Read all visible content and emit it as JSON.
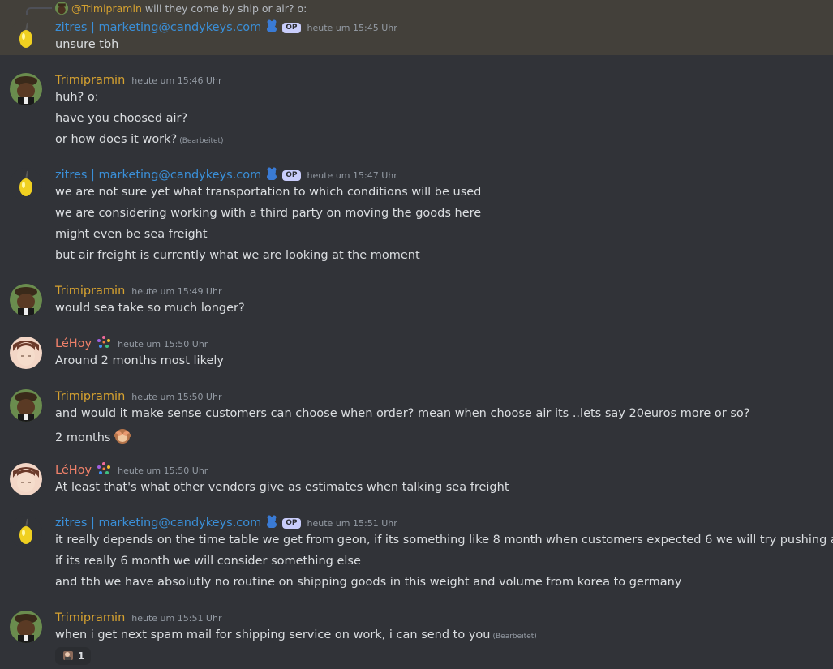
{
  "reply": {
    "mention": "@Trimipramin",
    "text": "will they come by ship or air? o:"
  },
  "badge_op": "OP",
  "messages": [
    {
      "author": "zitres | marketing@candykeys.com",
      "time": "heute um 15:45 Uhr",
      "lines": [
        "unsure tbh"
      ]
    },
    {
      "author": "Trimipramin",
      "time": "heute um 15:46 Uhr",
      "lines": [
        "huh? o:",
        "have you choosed air?",
        "or how does it work?"
      ],
      "edited": "(Bearbeitet)"
    },
    {
      "author": "zitres | marketing@candykeys.com",
      "time": "heute um 15:47 Uhr",
      "lines": [
        "we are not sure yet what transportation to which conditions will be used",
        "we are considering working with a third party on moving the goods here",
        "might even be sea freight",
        "but air freight is currently what we are looking at the moment"
      ]
    },
    {
      "author": "Trimipramin",
      "time": "heute um 15:49 Uhr",
      "lines": [
        "would sea take so much longer?"
      ]
    },
    {
      "author": "LéHoy",
      "time": "heute um 15:50 Uhr",
      "lines": [
        "Around 2 months most likely"
      ]
    },
    {
      "author": "Trimipramin",
      "time": "heute um 15:50 Uhr",
      "lines": [
        "and would it make sense customers can choose when order? mean when choose air its ..lets say 20euros more or so?",
        "2 months"
      ]
    },
    {
      "author": "LéHoy",
      "time": "heute um 15:50 Uhr",
      "lines": [
        "At least that's what other vendors give as estimates when talking sea freight"
      ]
    },
    {
      "author": "zitres | marketing@candykeys.com",
      "time": "heute um 15:51 Uhr",
      "lines": [
        "it really depends on the time table we get from geon, if its something like 8 month when customers expected 6 we will try pushing air",
        "if its really 6 month we will consider something else",
        "and tbh we have absolutly no routine on shipping goods in this weight and volume from korea to germany"
      ]
    },
    {
      "author": "Trimipramin",
      "time": "heute um 15:51 Uhr",
      "lines": [
        "when i get next spam mail for shipping service on work, i can send to you"
      ],
      "edited": "(Bearbeitet)",
      "reaction_count": "1"
    }
  ]
}
